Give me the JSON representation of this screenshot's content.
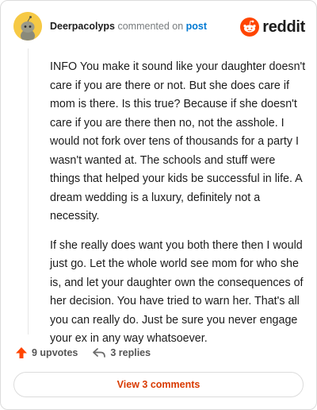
{
  "header": {
    "username": "Deerpacolyps",
    "commented_on_text": "commented on",
    "post_link": "post",
    "brand_name": "reddit",
    "brand_color": "#ff4500"
  },
  "comment": {
    "paragraphs": [
      "INFO You make it sound like your daughter doesn't care if you are there or not. But she does care if mom is there. Is this true? Because if she doesn't care if you are there then no, not the asshole. I would not fork over tens of thousands for a party I wasn't wanted at. The schools and stuff were things that helped your kids be successful in life. A dream wedding is a luxury, definitely not a necessity.",
      "If she really does want you both there then I would just go. Let the whole world see mom for who she is, and let your daughter own the consequences of her decision. You have tried to warn her. That's all you can really do. Just be sure you never engage your ex in any way whatsoever."
    ]
  },
  "actions": {
    "upvotes_label": "9 upvotes",
    "replies_label": "3 replies",
    "upvote_icon": "upvote-arrow-icon",
    "reply_icon": "reply-arrow-icon",
    "upvote_color": "#ff4500"
  },
  "footer": {
    "view_comments_label": "View 3 comments",
    "accent_color": "#d93a00"
  }
}
